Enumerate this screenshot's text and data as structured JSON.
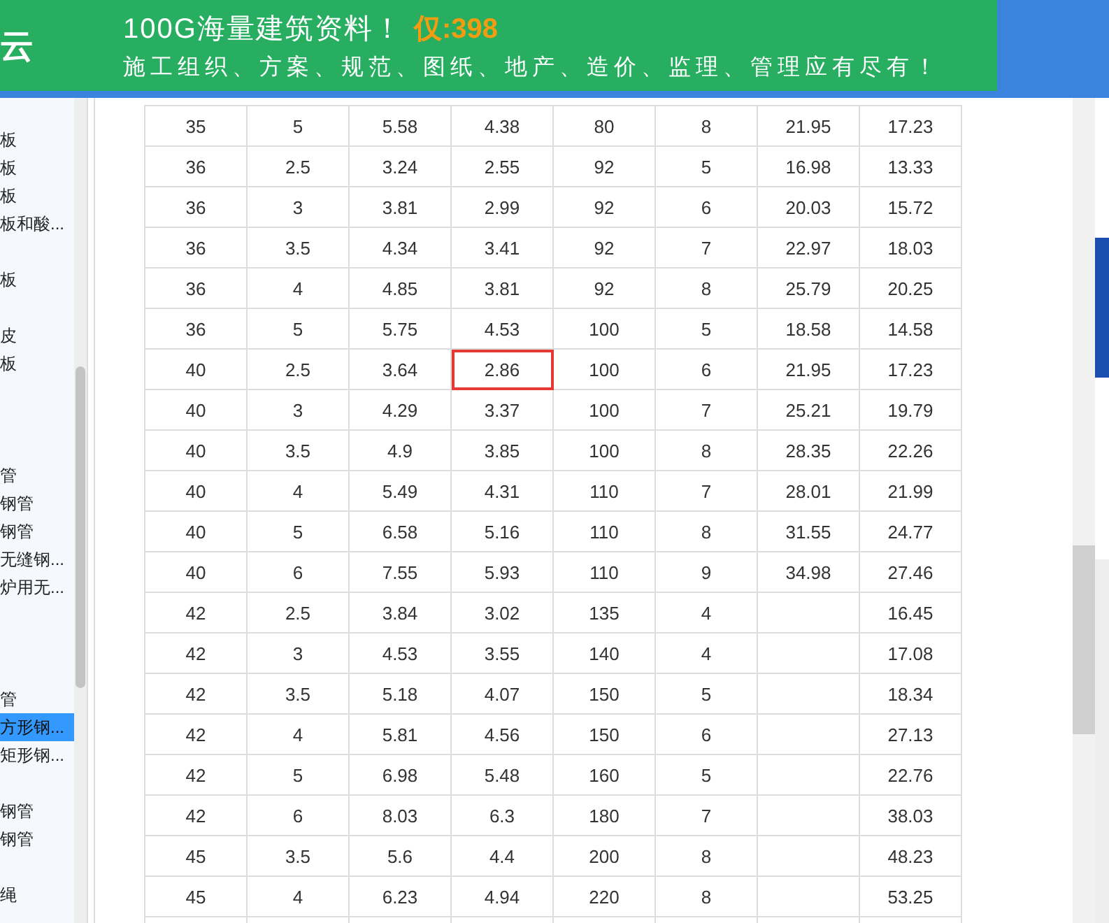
{
  "banner": {
    "logo_text": "云",
    "headline": "100G海量建筑资料！",
    "price": "仅:398",
    "subline": "施工组织、方案、规范、图纸、地产、造价、监理、管理应有尽有！"
  },
  "sidebar": {
    "items": [
      {
        "kind": "entry",
        "label": "板",
        "selected": false
      },
      {
        "kind": "entry",
        "label": "板",
        "selected": false
      },
      {
        "kind": "entry",
        "label": "板",
        "selected": false
      },
      {
        "kind": "entry",
        "label": "板和酸...",
        "selected": false
      },
      {
        "kind": "blank"
      },
      {
        "kind": "entry",
        "label": "板",
        "selected": false
      },
      {
        "kind": "blank"
      },
      {
        "kind": "entry",
        "label": "皮",
        "selected": false
      },
      {
        "kind": "entry",
        "label": "板",
        "selected": false
      },
      {
        "kind": "blank"
      },
      {
        "kind": "blank"
      },
      {
        "kind": "blank"
      },
      {
        "kind": "entry",
        "label": "管",
        "selected": false
      },
      {
        "kind": "entry",
        "label": "钢管",
        "selected": false
      },
      {
        "kind": "entry",
        "label": "钢管",
        "selected": false
      },
      {
        "kind": "entry",
        "label": "无缝钢...",
        "selected": false
      },
      {
        "kind": "entry",
        "label": "炉用无...",
        "selected": false
      },
      {
        "kind": "blank"
      },
      {
        "kind": "blank"
      },
      {
        "kind": "blank"
      },
      {
        "kind": "entry",
        "label": "管",
        "selected": false
      },
      {
        "kind": "entry",
        "label": "方形钢...",
        "selected": true
      },
      {
        "kind": "entry",
        "label": "矩形钢...",
        "selected": false
      },
      {
        "kind": "blank"
      },
      {
        "kind": "entry",
        "label": "钢管",
        "selected": false
      },
      {
        "kind": "entry",
        "label": "钢管",
        "selected": false
      },
      {
        "kind": "blank"
      },
      {
        "kind": "entry",
        "label": "绳",
        "selected": false
      }
    ]
  },
  "table": {
    "rows": [
      {
        "cells": [
          {
            "text": "35",
            "marked": false
          },
          {
            "text": "5",
            "marked": false
          },
          {
            "text": "5.58",
            "marked": false
          },
          {
            "text": "4.38",
            "marked": false
          },
          {
            "text": "80",
            "marked": false
          },
          {
            "text": "8",
            "marked": false
          },
          {
            "text": "21.95",
            "marked": false
          },
          {
            "text": "17.23",
            "marked": false
          }
        ]
      },
      {
        "cells": [
          {
            "text": "36",
            "marked": false
          },
          {
            "text": "2.5",
            "marked": false
          },
          {
            "text": "3.24",
            "marked": false
          },
          {
            "text": "2.55",
            "marked": false
          },
          {
            "text": "92",
            "marked": false
          },
          {
            "text": "5",
            "marked": false
          },
          {
            "text": "16.98",
            "marked": false
          },
          {
            "text": "13.33",
            "marked": false
          }
        ]
      },
      {
        "cells": [
          {
            "text": "36",
            "marked": false
          },
          {
            "text": "3",
            "marked": false
          },
          {
            "text": "3.81",
            "marked": false
          },
          {
            "text": "2.99",
            "marked": false
          },
          {
            "text": "92",
            "marked": false
          },
          {
            "text": "6",
            "marked": false
          },
          {
            "text": "20.03",
            "marked": false
          },
          {
            "text": "15.72",
            "marked": false
          }
        ]
      },
      {
        "cells": [
          {
            "text": "36",
            "marked": false
          },
          {
            "text": "3.5",
            "marked": false
          },
          {
            "text": "4.34",
            "marked": false
          },
          {
            "text": "3.41",
            "marked": false
          },
          {
            "text": "92",
            "marked": false
          },
          {
            "text": "7",
            "marked": false
          },
          {
            "text": "22.97",
            "marked": false
          },
          {
            "text": "18.03",
            "marked": false
          }
        ]
      },
      {
        "cells": [
          {
            "text": "36",
            "marked": false
          },
          {
            "text": "4",
            "marked": false
          },
          {
            "text": "4.85",
            "marked": false
          },
          {
            "text": "3.81",
            "marked": false
          },
          {
            "text": "92",
            "marked": false
          },
          {
            "text": "8",
            "marked": false
          },
          {
            "text": "25.79",
            "marked": false
          },
          {
            "text": "20.25",
            "marked": false
          }
        ]
      },
      {
        "cells": [
          {
            "text": "36",
            "marked": false
          },
          {
            "text": "5",
            "marked": false
          },
          {
            "text": "5.75",
            "marked": false
          },
          {
            "text": "4.53",
            "marked": false
          },
          {
            "text": "100",
            "marked": false
          },
          {
            "text": "5",
            "marked": false
          },
          {
            "text": "18.58",
            "marked": false
          },
          {
            "text": "14.58",
            "marked": false
          }
        ]
      },
      {
        "cells": [
          {
            "text": "40",
            "marked": false
          },
          {
            "text": "2.5",
            "marked": false
          },
          {
            "text": "3.64",
            "marked": false
          },
          {
            "text": "2.86",
            "marked": true
          },
          {
            "text": "100",
            "marked": false
          },
          {
            "text": "6",
            "marked": false
          },
          {
            "text": "21.95",
            "marked": false
          },
          {
            "text": "17.23",
            "marked": false
          }
        ]
      },
      {
        "cells": [
          {
            "text": "40",
            "marked": false
          },
          {
            "text": "3",
            "marked": false
          },
          {
            "text": "4.29",
            "marked": false
          },
          {
            "text": "3.37",
            "marked": false
          },
          {
            "text": "100",
            "marked": false
          },
          {
            "text": "7",
            "marked": false
          },
          {
            "text": "25.21",
            "marked": false
          },
          {
            "text": "19.79",
            "marked": false
          }
        ]
      },
      {
        "cells": [
          {
            "text": "40",
            "marked": false
          },
          {
            "text": "3.5",
            "marked": false
          },
          {
            "text": "4.9",
            "marked": false
          },
          {
            "text": "3.85",
            "marked": false
          },
          {
            "text": "100",
            "marked": false
          },
          {
            "text": "8",
            "marked": false
          },
          {
            "text": "28.35",
            "marked": false
          },
          {
            "text": "22.26",
            "marked": false
          }
        ]
      },
      {
        "cells": [
          {
            "text": "40",
            "marked": false
          },
          {
            "text": "4",
            "marked": false
          },
          {
            "text": "5.49",
            "marked": false
          },
          {
            "text": "4.31",
            "marked": false
          },
          {
            "text": "110",
            "marked": false
          },
          {
            "text": "7",
            "marked": false
          },
          {
            "text": "28.01",
            "marked": false
          },
          {
            "text": "21.99",
            "marked": false
          }
        ]
      },
      {
        "cells": [
          {
            "text": "40",
            "marked": false
          },
          {
            "text": "5",
            "marked": false
          },
          {
            "text": "6.58",
            "marked": false
          },
          {
            "text": "5.16",
            "marked": false
          },
          {
            "text": "110",
            "marked": false
          },
          {
            "text": "8",
            "marked": false
          },
          {
            "text": "31.55",
            "marked": false
          },
          {
            "text": "24.77",
            "marked": false
          }
        ]
      },
      {
        "cells": [
          {
            "text": "40",
            "marked": false
          },
          {
            "text": "6",
            "marked": false
          },
          {
            "text": "7.55",
            "marked": false
          },
          {
            "text": "5.93",
            "marked": false
          },
          {
            "text": "110",
            "marked": false
          },
          {
            "text": "9",
            "marked": false
          },
          {
            "text": "34.98",
            "marked": false
          },
          {
            "text": "27.46",
            "marked": false
          }
        ]
      },
      {
        "cells": [
          {
            "text": "42",
            "marked": false
          },
          {
            "text": "2.5",
            "marked": false
          },
          {
            "text": "3.84",
            "marked": false
          },
          {
            "text": "3.02",
            "marked": false
          },
          {
            "text": "135",
            "marked": false
          },
          {
            "text": "4",
            "marked": false
          },
          {
            "marked": false
          },
          {
            "text": "16.45",
            "marked": false
          }
        ]
      },
      {
        "cells": [
          {
            "text": "42",
            "marked": false
          },
          {
            "text": "3",
            "marked": false
          },
          {
            "text": "4.53",
            "marked": false
          },
          {
            "text": "3.55",
            "marked": false
          },
          {
            "text": "140",
            "marked": false
          },
          {
            "text": "4",
            "marked": false
          },
          {
            "marked": false
          },
          {
            "text": "17.08",
            "marked": false
          }
        ]
      },
      {
        "cells": [
          {
            "text": "42",
            "marked": false
          },
          {
            "text": "3.5",
            "marked": false
          },
          {
            "text": "5.18",
            "marked": false
          },
          {
            "text": "4.07",
            "marked": false
          },
          {
            "text": "150",
            "marked": false
          },
          {
            "text": "5",
            "marked": false
          },
          {
            "marked": false
          },
          {
            "text": "18.34",
            "marked": false
          }
        ]
      },
      {
        "cells": [
          {
            "text": "42",
            "marked": false
          },
          {
            "text": "4",
            "marked": false
          },
          {
            "text": "5.81",
            "marked": false
          },
          {
            "text": "4.56",
            "marked": false
          },
          {
            "text": "150",
            "marked": false
          },
          {
            "text": "6",
            "marked": false
          },
          {
            "marked": false
          },
          {
            "text": "27.13",
            "marked": false
          }
        ]
      },
      {
        "cells": [
          {
            "text": "42",
            "marked": false
          },
          {
            "text": "5",
            "marked": false
          },
          {
            "text": "6.98",
            "marked": false
          },
          {
            "text": "5.48",
            "marked": false
          },
          {
            "text": "160",
            "marked": false
          },
          {
            "text": "5",
            "marked": false
          },
          {
            "marked": false
          },
          {
            "text": "22.76",
            "marked": false
          }
        ]
      },
      {
        "cells": [
          {
            "text": "42",
            "marked": false
          },
          {
            "text": "6",
            "marked": false
          },
          {
            "text": "8.03",
            "marked": false
          },
          {
            "text": "6.3",
            "marked": false
          },
          {
            "text": "180",
            "marked": false
          },
          {
            "text": "7",
            "marked": false
          },
          {
            "marked": false
          },
          {
            "text": "38.03",
            "marked": false
          }
        ]
      },
      {
        "cells": [
          {
            "text": "45",
            "marked": false
          },
          {
            "text": "3.5",
            "marked": false
          },
          {
            "text": "5.6",
            "marked": false
          },
          {
            "text": "4.4",
            "marked": false
          },
          {
            "text": "200",
            "marked": false
          },
          {
            "text": "8",
            "marked": false
          },
          {
            "marked": false
          },
          {
            "text": "48.23",
            "marked": false
          }
        ]
      },
      {
        "cells": [
          {
            "text": "45",
            "marked": false
          },
          {
            "text": "4",
            "marked": false
          },
          {
            "text": "6.23",
            "marked": false
          },
          {
            "text": "4.94",
            "marked": false
          },
          {
            "text": "220",
            "marked": false
          },
          {
            "text": "8",
            "marked": false
          },
          {
            "marked": false
          },
          {
            "text": "53.25",
            "marked": false
          }
        ]
      }
    ]
  }
}
